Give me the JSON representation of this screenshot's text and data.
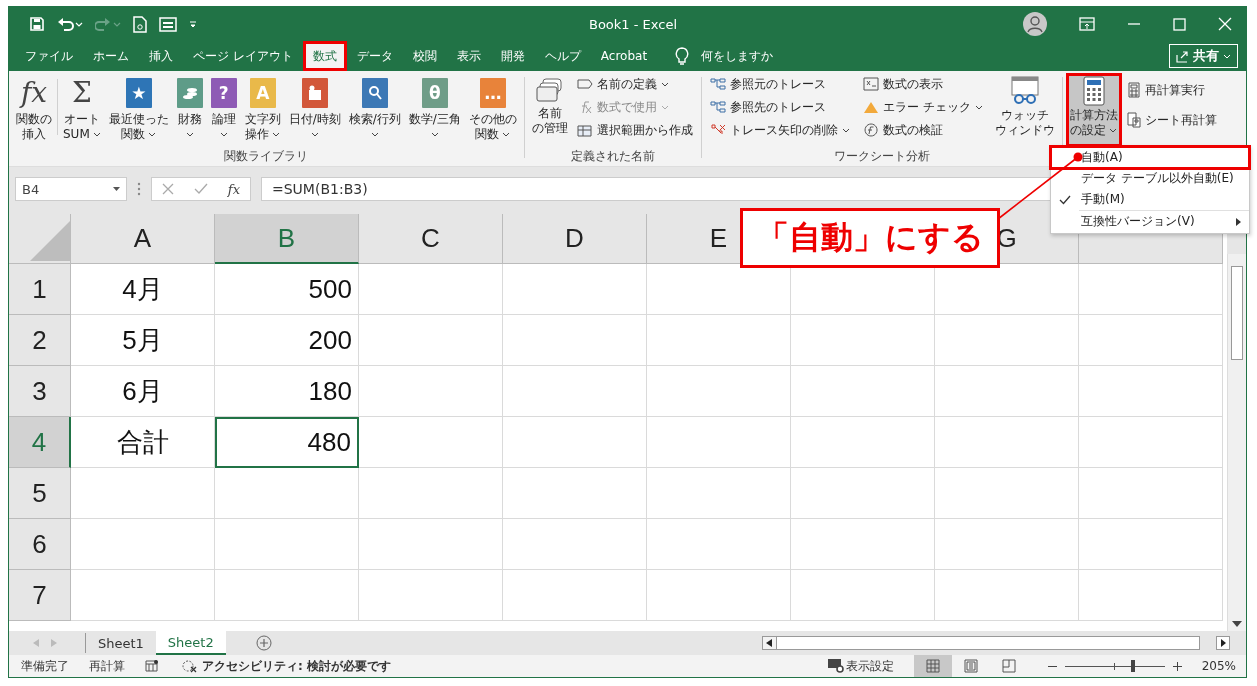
{
  "window": {
    "title": "Book1  -  Excel"
  },
  "tabs": [
    {
      "label": "ファイル",
      "selected": false,
      "annotated": false
    },
    {
      "label": "ホーム",
      "selected": false,
      "annotated": false
    },
    {
      "label": "挿入",
      "selected": false,
      "annotated": false
    },
    {
      "label": "ページ レイアウト",
      "selected": false,
      "annotated": false
    },
    {
      "label": "数式",
      "selected": true,
      "annotated": true
    },
    {
      "label": "データ",
      "selected": false,
      "annotated": false
    },
    {
      "label": "校閲",
      "selected": false,
      "annotated": false
    },
    {
      "label": "表示",
      "selected": false,
      "annotated": false
    },
    {
      "label": "開発",
      "selected": false,
      "annotated": false
    },
    {
      "label": "ヘルプ",
      "selected": false,
      "annotated": false
    },
    {
      "label": "Acrobat",
      "selected": false,
      "annotated": false
    }
  ],
  "tell_me": {
    "placeholder": "何をしますか"
  },
  "share_button": {
    "label": "共有"
  },
  "function_library": {
    "label": "関数ライブラリ",
    "buttons": [
      {
        "lines": [
          "関数の",
          "挿入"
        ],
        "caret": false,
        "icon": {
          "kind": "glyph",
          "glyph": "fx"
        }
      },
      {
        "lines": [
          "オート",
          "SUM"
        ],
        "caret": true,
        "icon": {
          "kind": "glyph",
          "glyph": "Σ"
        }
      },
      {
        "lines": [
          "最近使った",
          "関数"
        ],
        "caret": true,
        "icon": {
          "kind": "book",
          "color": "#2e75b6",
          "glyph": "★"
        }
      },
      {
        "lines": [
          "財務"
        ],
        "caret": true,
        "icon": {
          "kind": "coins",
          "color": "#5e9c88"
        }
      },
      {
        "lines": [
          "論理"
        ],
        "caret": true,
        "icon": {
          "kind": "book",
          "color": "#8e5bb5",
          "glyph": "?"
        }
      },
      {
        "lines": [
          "文字列",
          "操作"
        ],
        "caret": true,
        "icon": {
          "kind": "book",
          "color": "#e9b94a",
          "glyph": "A"
        }
      },
      {
        "lines": [
          "日付/時刻"
        ],
        "caret": true,
        "icon": {
          "kind": "calendar",
          "color": "#d2573a"
        }
      },
      {
        "lines": [
          "検索/行列"
        ],
        "caret": true,
        "icon": {
          "kind": "search",
          "color": "#3c78b5"
        }
      },
      {
        "lines": [
          "数学/三角"
        ],
        "caret": true,
        "icon": {
          "kind": "book",
          "color": "#6f9d88",
          "glyph": "θ"
        }
      },
      {
        "lines": [
          "その他の",
          "関数"
        ],
        "caret": true,
        "icon": {
          "kind": "book",
          "color": "#e8833a",
          "glyph": "…"
        }
      }
    ]
  },
  "defined_names": {
    "label": "定義された名前",
    "big": {
      "lines": [
        "名前",
        "の管理"
      ]
    },
    "items": [
      {
        "label": "名前の定義",
        "kind": "tag",
        "caret": true,
        "disabled": false
      },
      {
        "label": "数式で使用",
        "kind": "fx",
        "caret": true,
        "disabled": true
      },
      {
        "label": "選択範囲から作成",
        "kind": "table",
        "caret": false,
        "disabled": false
      }
    ]
  },
  "formula_auditing": {
    "label": "ワークシート分析",
    "columns": [
      [
        {
          "label": "参照元のトレース",
          "kind": "trace",
          "caret": false
        },
        {
          "label": "参照先のトレース",
          "kind": "trace",
          "caret": false
        },
        {
          "label": "トレース矢印の削除",
          "kind": "remove",
          "caret": true
        }
      ],
      [
        {
          "label": "数式の表示",
          "kind": "show",
          "caret": false
        },
        {
          "label": "エラー チェック",
          "kind": "error",
          "caret": true
        },
        {
          "label": "数式の検証",
          "kind": "evaluate",
          "caret": false
        }
      ]
    ],
    "big": {
      "lines": [
        "ウォッチ",
        "ウィンドウ"
      ]
    }
  },
  "calculation": {
    "big": {
      "lines": [
        "計算方法",
        "の設定"
      ],
      "caret": true,
      "pressed": true,
      "annotated": true
    },
    "items": [
      {
        "label": "再計算実行",
        "kind": "calc"
      },
      {
        "label": "シート再計算",
        "kind": "sheetcalc"
      }
    ]
  },
  "calc_menu": {
    "items": [
      {
        "label": "自動(A)",
        "checked": false,
        "submenu": false,
        "annotated": true
      },
      {
        "label": "データ テーブル以外自動(E)",
        "checked": false,
        "submenu": false,
        "annotated": false
      },
      {
        "label": "手動(M)",
        "checked": true,
        "submenu": false,
        "annotated": false
      },
      {
        "label": "互換性バージョン(V)",
        "checked": false,
        "submenu": true,
        "annotated": false
      }
    ]
  },
  "callout": {
    "text": "「自動」にする"
  },
  "formula_bar": {
    "name_box": "B4",
    "function_glyph": "fx",
    "formula": "=SUM(B1:B3)"
  },
  "sheet": {
    "columns": [
      {
        "label": "A",
        "selected": false
      },
      {
        "label": "B",
        "selected": true
      },
      {
        "label": "C",
        "selected": false
      },
      {
        "label": "D",
        "selected": false
      },
      {
        "label": "E",
        "selected": false
      },
      {
        "label": "G",
        "selected": false
      }
    ],
    "rows": [
      {
        "label": "1",
        "selected": false,
        "cells": [
          {
            "text": "4月",
            "selected": false
          },
          {
            "text": "500",
            "selected": false
          }
        ]
      },
      {
        "label": "2",
        "selected": false,
        "cells": [
          {
            "text": "5月",
            "selected": false
          },
          {
            "text": "200",
            "selected": false
          }
        ]
      },
      {
        "label": "3",
        "selected": false,
        "cells": [
          {
            "text": "6月",
            "selected": false
          },
          {
            "text": "180",
            "selected": false
          }
        ]
      },
      {
        "label": "4",
        "selected": true,
        "cells": [
          {
            "text": "合計",
            "selected": false
          },
          {
            "text": "480",
            "selected": true
          }
        ]
      },
      {
        "label": "5",
        "selected": false,
        "cells": []
      },
      {
        "label": "6",
        "selected": false,
        "cells": []
      },
      {
        "label": "7",
        "selected": false,
        "cells": []
      }
    ]
  },
  "sheet_tabs": [
    {
      "label": "Sheet1",
      "selected": false
    },
    {
      "label": "Sheet2",
      "selected": true
    }
  ],
  "status_bar": {
    "left": [
      "準備完了",
      "再計算"
    ],
    "accessibility": "アクセシビリティ: 検討が必要です",
    "display_settings": "表示設定",
    "views": [
      {
        "kind": "normal",
        "selected": true
      },
      {
        "kind": "page-layout",
        "selected": false
      },
      {
        "kind": "page-break",
        "selected": false
      }
    ],
    "zoom": {
      "level": 0.68,
      "reading": "205%"
    }
  }
}
